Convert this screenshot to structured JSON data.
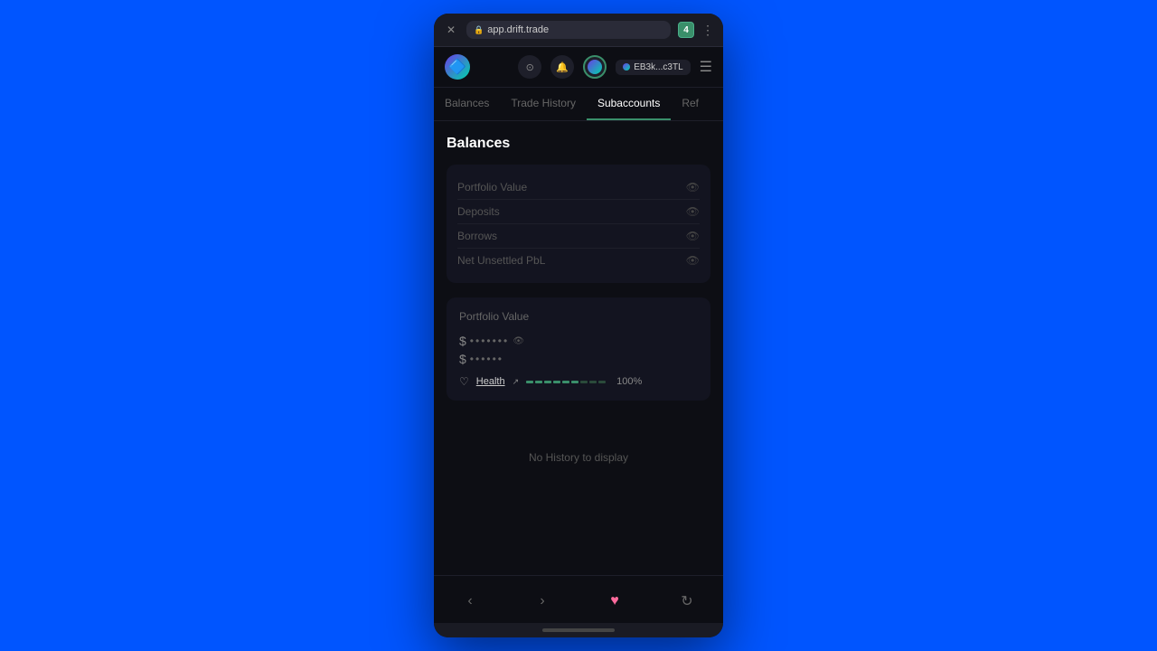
{
  "browser": {
    "close_label": "✕",
    "url": "app.drift.trade",
    "tab_count": "4",
    "menu_dots": "⋮"
  },
  "header": {
    "logo_emoji": "◈",
    "wallet_address": "EB3k...c3TL",
    "hamburger": "☰"
  },
  "nav": {
    "tabs": [
      {
        "label": "Balances",
        "active": false
      },
      {
        "label": "Trade History",
        "active": false
      },
      {
        "label": "Subaccounts",
        "active": true
      },
      {
        "label": "Ref",
        "active": false
      }
    ]
  },
  "balances": {
    "section_title": "Balances",
    "rows": [
      {
        "label": "Portfolio Value"
      },
      {
        "label": "Deposits"
      },
      {
        "label": "Borrows"
      },
      {
        "label": "Net Unsettled PbL"
      }
    ]
  },
  "portfolio_value": {
    "section_title": "Portfolio Value",
    "primary_currency": "$",
    "primary_dots": "•••••••",
    "secondary_currency": "$",
    "secondary_dots": "••••••",
    "health_label": "Health",
    "health_percent": "100%",
    "health_segments": [
      1,
      1,
      1,
      1,
      1,
      1,
      0,
      0,
      0
    ]
  },
  "no_history": {
    "message": "No History to display"
  },
  "bottom_nav": {
    "back": "‹",
    "forward": "›",
    "heart": "♥",
    "refresh": "↻"
  }
}
